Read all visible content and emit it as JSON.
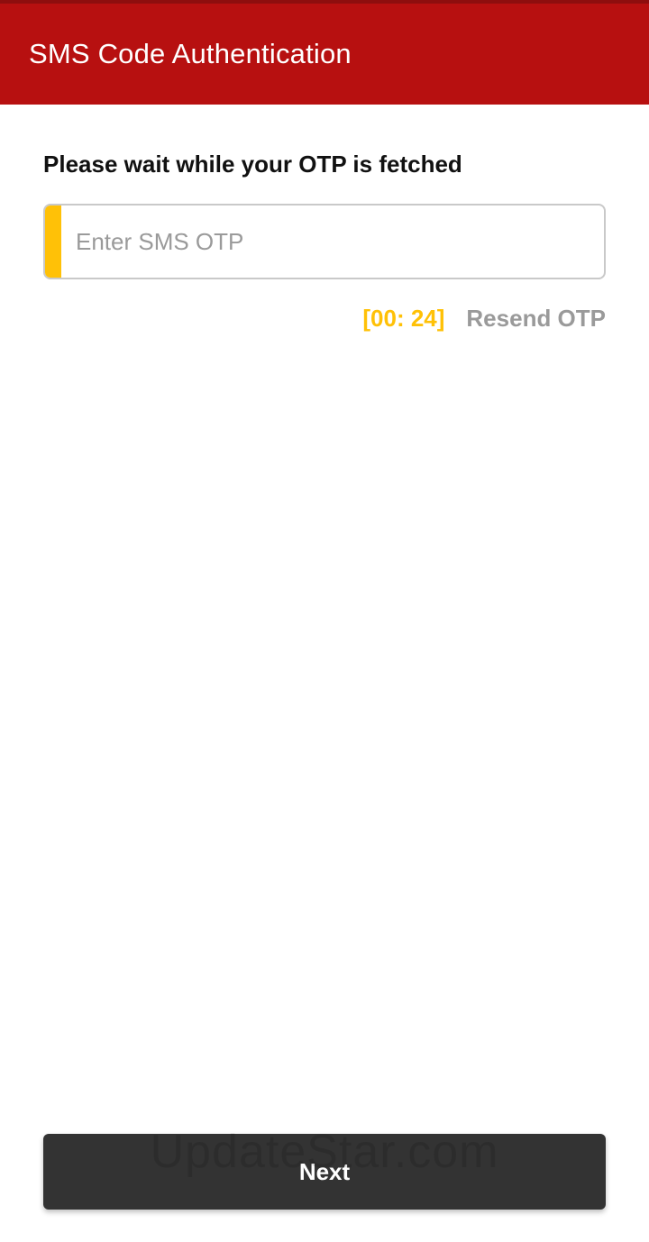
{
  "appbar": {
    "title": "SMS Code Authentication",
    "color": "#b71010"
  },
  "main": {
    "prompt": "Please wait while your OTP is fetched",
    "otp_input": {
      "placeholder": "Enter SMS OTP",
      "value": "",
      "accent_color": "#ffc107"
    },
    "timer": "[00: 24]",
    "resend_label": "Resend OTP"
  },
  "footer": {
    "next_label": "Next",
    "watermark": "UpdateStar.com"
  }
}
